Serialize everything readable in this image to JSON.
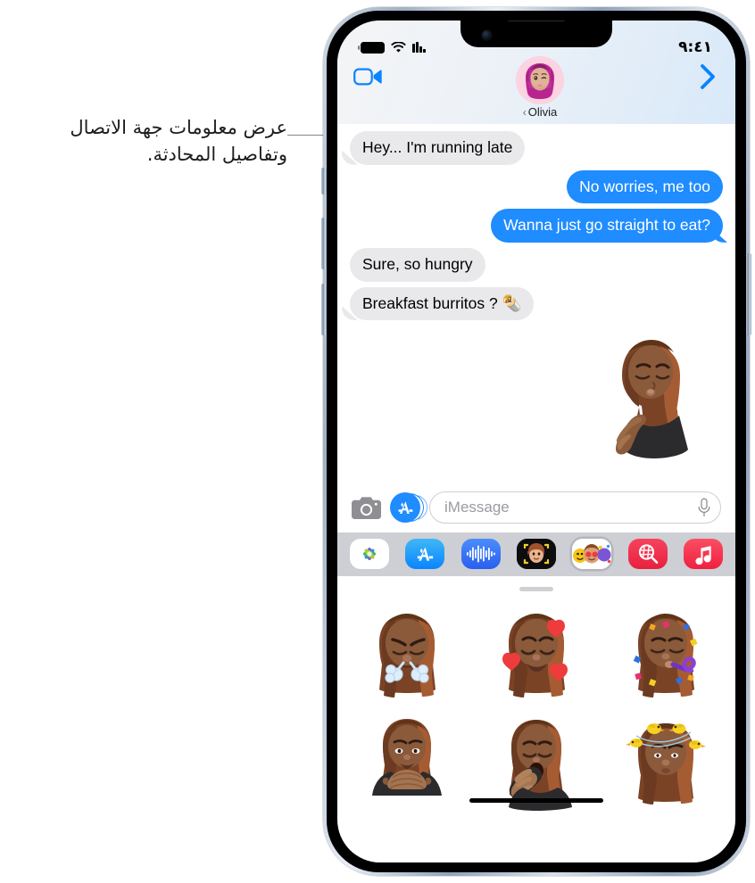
{
  "callout": {
    "text": "عرض معلومات جهة الاتصال وتفاصيل المحادثة."
  },
  "status_bar": {
    "time": "٩:٤١",
    "battery_icon": "battery-icon",
    "wifi_icon": "wifi-icon",
    "cellular_icon": "cellular-bars-icon"
  },
  "nav_bar": {
    "video_call_icon": "video-camera-icon",
    "back_chevron_icon": "chevron-right-icon",
    "contact_name": "Olivia",
    "contact_chevron": "‹",
    "avatar_label": "Olivia memoji avatar"
  },
  "thread": {
    "messages": [
      {
        "text": "Hey... I'm running late",
        "side": "in",
        "tail": true
      },
      {
        "text": "No worries, me too",
        "side": "out",
        "tail": false
      },
      {
        "text": "Wanna just go straight to eat?",
        "side": "out",
        "tail": true
      },
      {
        "text": "Sure, so hungry",
        "side": "in",
        "tail": false
      },
      {
        "text": "Breakfast burritos ? 🌯",
        "side": "in",
        "tail": true
      }
    ],
    "sticker_message": "memoji-kiss-sticker"
  },
  "input_bar": {
    "camera_icon": "camera-icon",
    "apps_icon": "app-store-icon",
    "placeholder": "iMessage",
    "value": "",
    "mic_icon": "microphone-icon"
  },
  "app_drawer": {
    "items": [
      {
        "name": "photos-app-icon",
        "label": "Photos",
        "selected": false
      },
      {
        "name": "app-store-icon",
        "label": "App Store",
        "selected": false
      },
      {
        "name": "audio-app-icon",
        "label": "Audio",
        "selected": false
      },
      {
        "name": "memoji-app-icon",
        "label": "Memoji",
        "selected": false
      },
      {
        "name": "stickers-app-icon",
        "label": "Memoji Stickers",
        "selected": true
      },
      {
        "name": "images-app-icon",
        "label": "#images",
        "selected": false
      },
      {
        "name": "music-app-icon",
        "label": "Music",
        "selected": false
      }
    ]
  },
  "sticker_panel": {
    "grabber": "drag-handle",
    "stickers": [
      {
        "name": "memoji-sticker-party",
        "label": "Party horn celebration"
      },
      {
        "name": "memoji-sticker-hearts",
        "label": "Smiling with hearts"
      },
      {
        "name": "memoji-sticker-steam",
        "label": "Steam from nose"
      },
      {
        "name": "memoji-sticker-birds",
        "label": "Birds around head"
      },
      {
        "name": "memoji-sticker-yawn",
        "label": "Yawning"
      },
      {
        "name": "memoji-sticker-hands-chin",
        "label": "Hands under chin"
      }
    ]
  },
  "colors": {
    "imessage_blue": "#1f8cff",
    "received_gray": "#e9e9eb",
    "drawer_gray": "#cdcfd4",
    "accent_blue": "#0a84ff"
  }
}
